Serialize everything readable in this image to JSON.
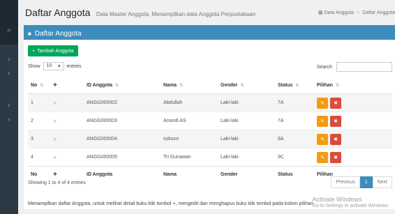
{
  "page": {
    "title": "Daftar Anggota",
    "subtitle": "Data Master Anggota, Menampilkan data Anggota Perpustakaan",
    "breadcrumb": [
      "Data Anggota",
      "Daftar Anggota"
    ]
  },
  "box": {
    "title": "Daftar Anggota",
    "add_button": "Tambah Anggota"
  },
  "controls": {
    "show_label": "Show",
    "entries_value": "10",
    "entries_label": "entries",
    "search_label": "Search"
  },
  "table": {
    "headers": [
      "No",
      "",
      "ID Anggota",
      "Nama",
      "Gender",
      "Status",
      "Pilihan"
    ],
    "rows": [
      {
        "no": "1",
        "id": "ANGG000002",
        "nama": "Abdullah",
        "gender": "Laki-laki",
        "status": "7A"
      },
      {
        "no": "2",
        "id": "ANGG000003",
        "nama": "Ariandi AS",
        "gender": "Laki-laki",
        "status": "7A"
      },
      {
        "no": "3",
        "id": "ANGG000004",
        "nama": "sukoco",
        "gender": "Laki-laki",
        "status": "8A"
      },
      {
        "no": "4",
        "id": "ANGG000005",
        "nama": "Tri Gunawan",
        "gender": "Laki-laki",
        "status": "9C"
      }
    ]
  },
  "pagination": {
    "info": "Showing 1 to 4 of 4 entries",
    "previous": "Previous",
    "current": "1",
    "next": "Next"
  },
  "footer_note": "Menampilkan daftar Anggota, untuk melihat detail buku klik tombol +, mengedit dan menghapus buku klik tombol pada kolom pilihan",
  "watermark": {
    "line1": "Activate Windows",
    "line2": "Go to Settings to activate Windows."
  }
}
